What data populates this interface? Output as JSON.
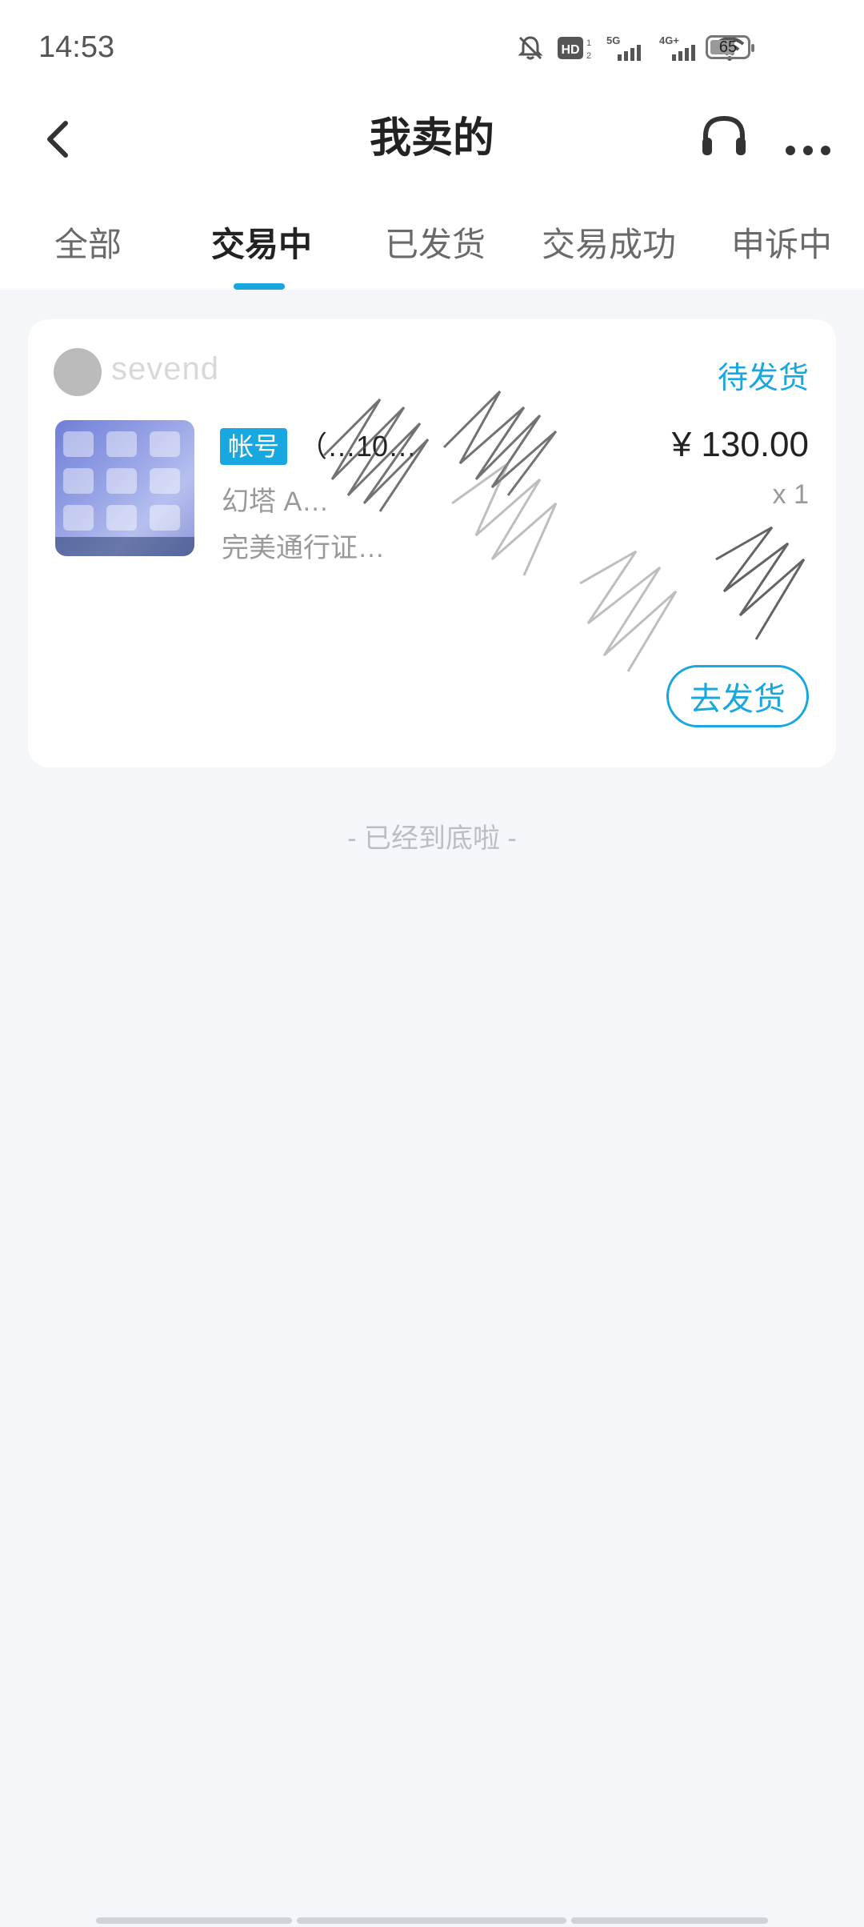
{
  "status_bar": {
    "time": "14:53",
    "battery": "65",
    "icons": [
      "mute-bell-icon",
      "hd-icon",
      "5g-signal-icon",
      "4g-signal-icon",
      "wifi-icon",
      "battery-icon"
    ]
  },
  "header": {
    "title": "我卖的",
    "back_icon": "back-arrow-icon",
    "service_icon": "headset-icon",
    "more_icon": "more-dots-icon"
  },
  "tabs": [
    "全部",
    "交易中",
    "已发货",
    "交易成功",
    "申诉中"
  ],
  "active_tab": "交易中",
  "order": {
    "seller": "sevend",
    "status": "待发货",
    "tag": "帐号",
    "title": "（…10…",
    "price": "¥ 130.00",
    "game_line": "幻塔 A…",
    "quantity": "x 1",
    "desc_line": "完美通行证…",
    "action_label": "去发货"
  },
  "end_text": "- 已经到底啦 -",
  "colors": {
    "accent": "#19a7e0",
    "background": "#f4f6f9",
    "text_primary": "#222222",
    "text_secondary": "#999999"
  }
}
